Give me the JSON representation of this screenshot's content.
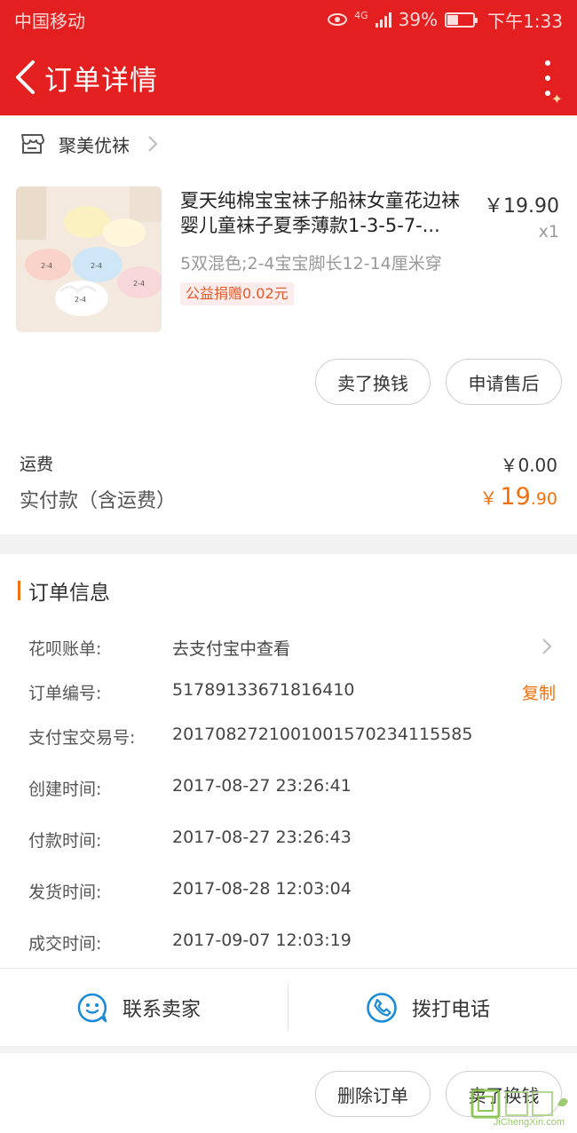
{
  "status_bar": {
    "carrier": "中国移动",
    "network": "4G",
    "battery": "39%",
    "time": "下午1:33"
  },
  "nav": {
    "title": "订单详情"
  },
  "shop": {
    "name": "聚美优袜"
  },
  "product": {
    "title": "夏天纯棉宝宝袜子船袜女童花边袜婴儿童袜子夏季薄款1-3-5-7-...",
    "price": "￥19.90",
    "qty": "x1",
    "spec": "5双混色;2-4宝宝脚长12-14厘米穿",
    "charity": "公益捐赠0.02元",
    "image_labels": [
      "2-4",
      "2-4",
      "2-4",
      "2-4"
    ]
  },
  "product_actions": {
    "sell": "卖了换钱",
    "after_sale": "申请售后"
  },
  "fees": {
    "shipping_label": "运费",
    "shipping_value": "￥0.00",
    "total_label": "实付款（含运费）",
    "total_symbol": "￥",
    "total_int": "19",
    "total_dec": ".90"
  },
  "order_info": {
    "title": "订单信息",
    "rows": [
      {
        "label": "花呗账单:",
        "value": "去支付宝中查看"
      },
      {
        "label": "订单编号:",
        "value": "51789133671816410",
        "action": "复制"
      },
      {
        "label": "支付宝交易号:",
        "value": "2017082721001001570234115585"
      },
      {
        "label": "创建时间:",
        "value": "2017-08-27 23:26:41"
      },
      {
        "label": "付款时间:",
        "value": "2017-08-27 23:26:43"
      },
      {
        "label": "发货时间:",
        "value": "2017-08-28 12:03:04"
      },
      {
        "label": "成交时间:",
        "value": "2017-09-07 12:03:19"
      }
    ]
  },
  "contact": {
    "seller": "联系卖家",
    "call": "拨打电话"
  },
  "bottom_actions": {
    "delete": "删除订单",
    "sell": "卖了换钱"
  },
  "watermark": {
    "text": "JiChengXin.com"
  },
  "colors": {
    "header": "#e41f1f",
    "accent": "#f2700c",
    "icon_blue": "#1a8bd8"
  }
}
